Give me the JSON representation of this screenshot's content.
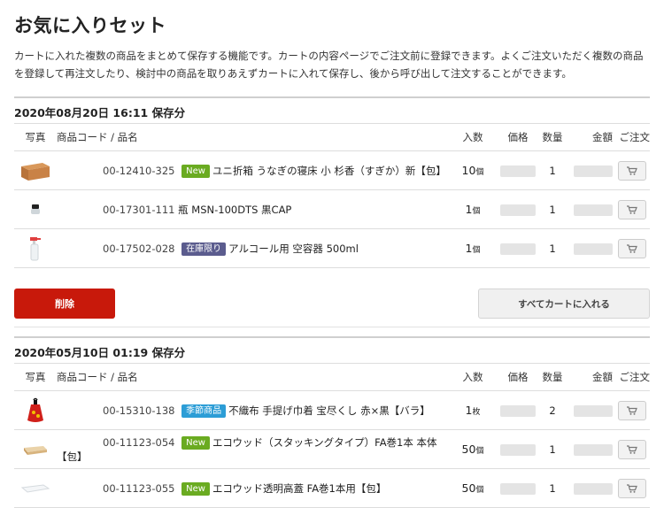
{
  "page": {
    "title": "お気に入りセット",
    "description": "カートに入れた複数の商品をまとめて保存する機能です。カートの内容ページでご注文前に登録できます。よくご注文いただく複数の商品を登録して再注文したり、検討中の商品を取りあえずカートに入れて保存し、後から呼び出して注文することができます。"
  },
  "columns": {
    "photo": "写真",
    "name": "商品コード / 品名",
    "qty_unit": "入数",
    "price": "価格",
    "count": "数量",
    "amount": "金額",
    "order": "ご注文"
  },
  "sets": [
    {
      "title": "2020年08月20日 16:11 保存分",
      "items": [
        {
          "code": "00-12410-325",
          "badge": "New",
          "name": "ユニ折箱 うなぎの寝床 小 杉香（すぎか）新【包】",
          "qty": "10",
          "unit": "個",
          "count": "1"
        },
        {
          "code": "00-17301-111",
          "badge": "",
          "name": "瓶 MSN-100DTS 黒CAP",
          "qty": "1",
          "unit": "個",
          "count": "1"
        },
        {
          "code": "00-17502-028",
          "badge": "在庫限り",
          "name": "アルコール用 空容器 500ml",
          "qty": "1",
          "unit": "個",
          "count": "1"
        }
      ],
      "delete_label": "削除",
      "add_all_label": "すべてカートに入れる"
    },
    {
      "title": "2020年05月10日 01:19 保存分",
      "items": [
        {
          "code": "00-15310-138",
          "badge": "季節商品",
          "name": "不織布 手提げ巾着 宝尽くし 赤×黒【バラ】",
          "qty": "1",
          "unit": "枚",
          "count": "2"
        },
        {
          "code": "00-11123-054",
          "badge": "New",
          "name": "エコウッド（スタッキングタイプ）FA巻1本 本体【包】",
          "qty": "50",
          "unit": "個",
          "count": "1"
        },
        {
          "code": "00-11123-055",
          "badge": "New",
          "name": "エコウッド透明高蓋 FA巻1本用【包】",
          "qty": "50",
          "unit": "個",
          "count": "1"
        }
      ]
    }
  ],
  "colors": {
    "new_badge": "#6aab21",
    "stock_badge": "#5b5c8e",
    "season_badge": "#2c9dd6",
    "delete_button": "#c8190b"
  }
}
